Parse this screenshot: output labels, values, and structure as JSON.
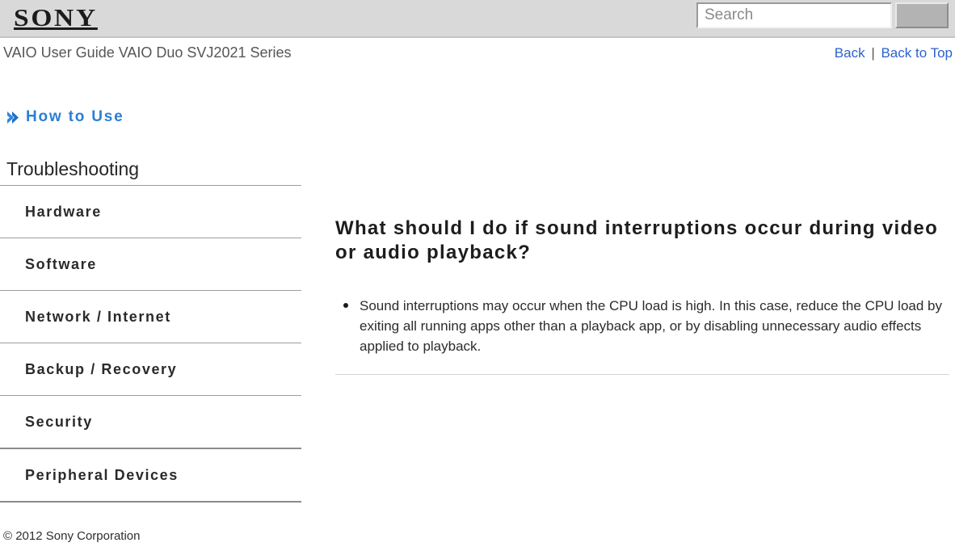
{
  "brand": {
    "logo_text": "SONY",
    "logo_icon": "sony-wordmark"
  },
  "search": {
    "value": "",
    "placeholder": "Search",
    "button_label": "",
    "button_icon": "search-submit-button"
  },
  "header": {
    "guide_title": "VAIO User Guide VAIO Duo SVJ2021 Series",
    "links": [
      {
        "label": "Back"
      },
      {
        "label": "Back to Top"
      }
    ],
    "separator": "|"
  },
  "sidebar": {
    "howto": {
      "label": "How to Use",
      "icon": "chevron-right-double-icon",
      "color": "#2b7fd4"
    },
    "section_title": "Troubleshooting",
    "items": [
      {
        "label": "Hardware"
      },
      {
        "label": "Software"
      },
      {
        "label": "Network / Internet"
      },
      {
        "label": "Backup / Recovery"
      },
      {
        "label": "Security"
      },
      {
        "label": "Peripheral Devices"
      }
    ]
  },
  "main": {
    "heading": "What should I do if sound interruptions occur during video or audio playback?",
    "bullets": [
      "Sound interruptions may occur when the CPU load is high. In this case, reduce the CPU load by exiting all running apps other than a playback app, or by disabling unnecessary audio effects applied to playback."
    ]
  },
  "footer": {
    "copyright": "© 2012 Sony Corporation"
  },
  "colors": {
    "link": "#2b62cc",
    "accent": "#2b7fd4",
    "header_bg": "#d9d9d9",
    "rule": "#9d9d9d",
    "rule_strong": "#8c8c8c"
  }
}
